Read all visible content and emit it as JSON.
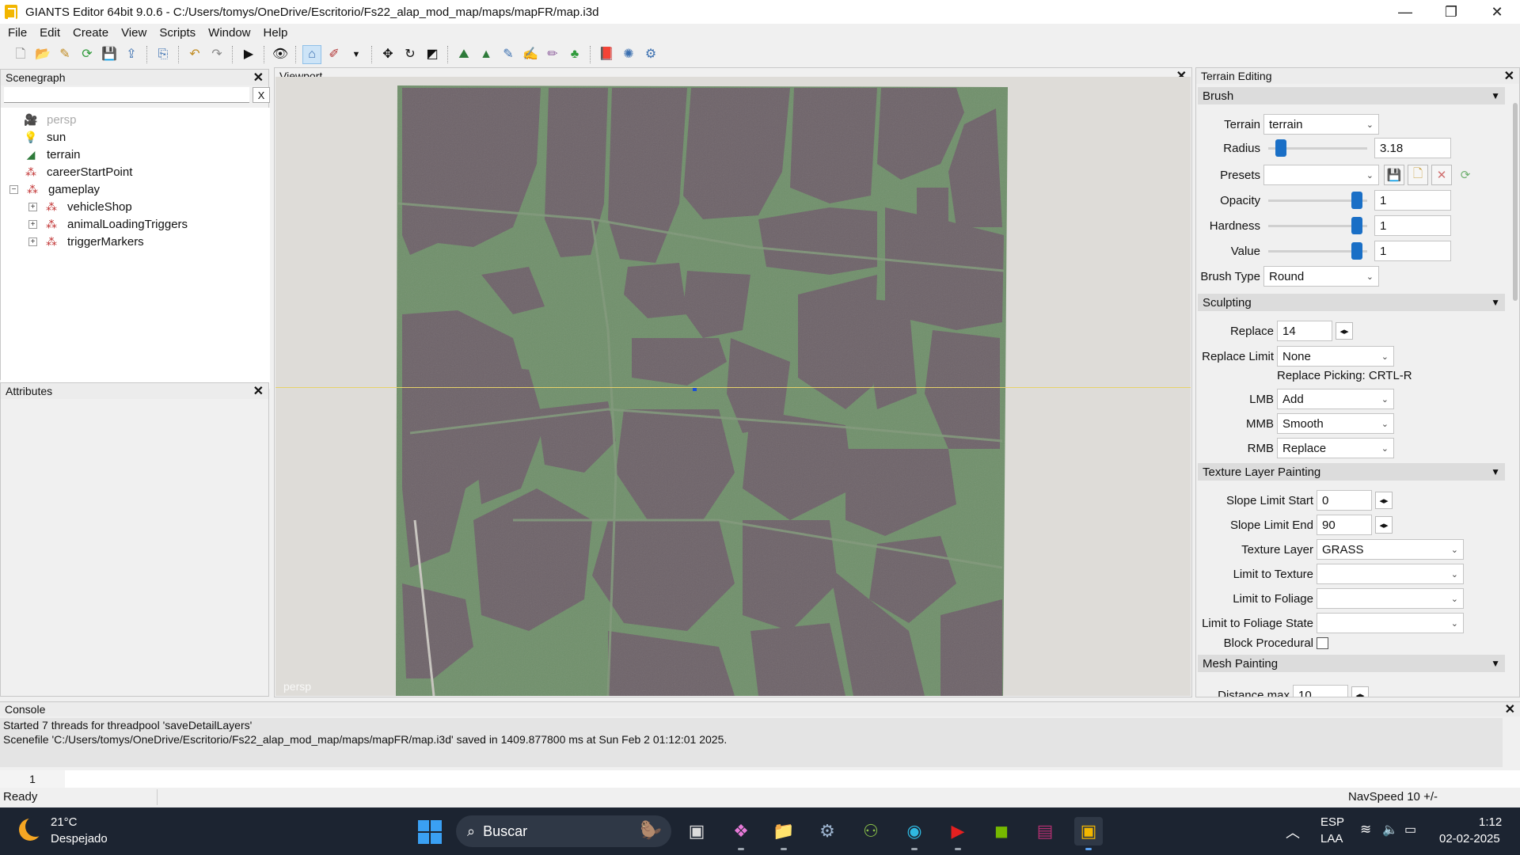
{
  "window": {
    "title": "GIANTS Editor 64bit 9.0.6 - C:/Users/tomys/OneDrive/Escritorio/Fs22_alap_mod_map/maps/mapFR/map.i3d",
    "minimize": "—",
    "maximize": "❐",
    "close": "✕"
  },
  "menu": [
    "File",
    "Edit",
    "Create",
    "View",
    "Scripts",
    "Window",
    "Help"
  ],
  "scenegraph": {
    "title": "Scenegraph",
    "close": "✕",
    "search_value": "",
    "clear_label": "X",
    "items": [
      {
        "label": "persp",
        "icon": "camera-icon"
      },
      {
        "label": "sun",
        "icon": "light-bulb-icon"
      },
      {
        "label": "terrain",
        "icon": "terrain-icon"
      },
      {
        "label": "careerStartPoint",
        "icon": "transform-group-icon"
      },
      {
        "label": "gameplay",
        "icon": "transform-group-icon",
        "expander": "−"
      },
      {
        "label": "vehicleShop",
        "icon": "transform-group-icon",
        "expander": "+"
      },
      {
        "label": "animalLoadingTriggers",
        "icon": "transform-group-icon",
        "expander": "+"
      },
      {
        "label": "triggerMarkers",
        "icon": "transform-group-icon",
        "expander": "+"
      }
    ]
  },
  "attributes": {
    "title": "Attributes",
    "close": "✕"
  },
  "viewport": {
    "title": "Viewport",
    "close": "✕",
    "camera_label": "persp"
  },
  "terrain_editing": {
    "title": "Terrain Editing",
    "close": "✕",
    "brush": {
      "title": "Brush",
      "terrain_label": "Terrain",
      "terrain_value": "terrain",
      "radius_label": "Radius",
      "radius_value": "3.18",
      "radius_level": 0.08,
      "presets_label": "Presets",
      "presets_value": "",
      "opacity_label": "Opacity",
      "opacity_value": "1",
      "opacity_level": 0.95,
      "hardness_label": "Hardness",
      "hardness_value": "1",
      "hardness_level": 0.95,
      "value_label": "Value",
      "value_value": "1",
      "value_level": 0.95,
      "brush_type_label": "Brush Type",
      "brush_type_value": "Round"
    },
    "sculpting": {
      "title": "Sculpting",
      "replace_label": "Replace",
      "replace_value": "14",
      "replace_limit_label": "Replace Limit",
      "replace_limit_value": "None",
      "replace_picking": "Replace Picking: CRTL-R",
      "lmb_label": "LMB",
      "lmb_value": "Add",
      "mmb_label": "MMB",
      "mmb_value": "Smooth",
      "rmb_label": "RMB",
      "rmb_value": "Replace"
    },
    "texture_painting": {
      "title": "Texture Layer Painting",
      "slope_start_label": "Slope Limit Start",
      "slope_start_value": "0",
      "slope_end_label": "Slope Limit End",
      "slope_end_value": "90",
      "texture_layer_label": "Texture Layer",
      "texture_layer_value": "GRASS",
      "limit_texture_label": "Limit to Texture",
      "limit_texture_value": "",
      "limit_foliage_label": "Limit to Foliage",
      "limit_foliage_value": "",
      "limit_foliage_state_label": "Limit to Foliage State",
      "limit_foliage_state_value": "",
      "block_procedural_label": "Block Procedural"
    },
    "mesh_painting": {
      "title": "Mesh Painting",
      "distance_max_label": "Distance max",
      "distance_max_value": "10"
    }
  },
  "console": {
    "title": "Console",
    "close": "✕",
    "lines": [
      "Started 7 threads for threadpool 'saveDetailLayers'",
      "Scenefile 'C:/Users/tomys/OneDrive/Escritorio/Fs22_alap_mod_map/maps/mapFR/map.i3d' saved in 1409.877800 ms at Sun Feb  2 01:12:01 2025."
    ],
    "line_number": "1"
  },
  "statusbar": {
    "status": "Ready",
    "nav_speed": "NavSpeed 10 +/-"
  },
  "taskbar": {
    "weather_temp": "21°C",
    "weather_desc": "Despejado",
    "search_placeholder": "Buscar",
    "lang_top": "ESP",
    "lang_bottom": "LAA",
    "time": "1:12",
    "date": "02-02-2025"
  },
  "colors": {
    "accent_blue": "#1a6fc6",
    "terrain_green": "#6f8f6a",
    "field_mauve": "#6d6268",
    "taskbar": "#1c2431"
  }
}
